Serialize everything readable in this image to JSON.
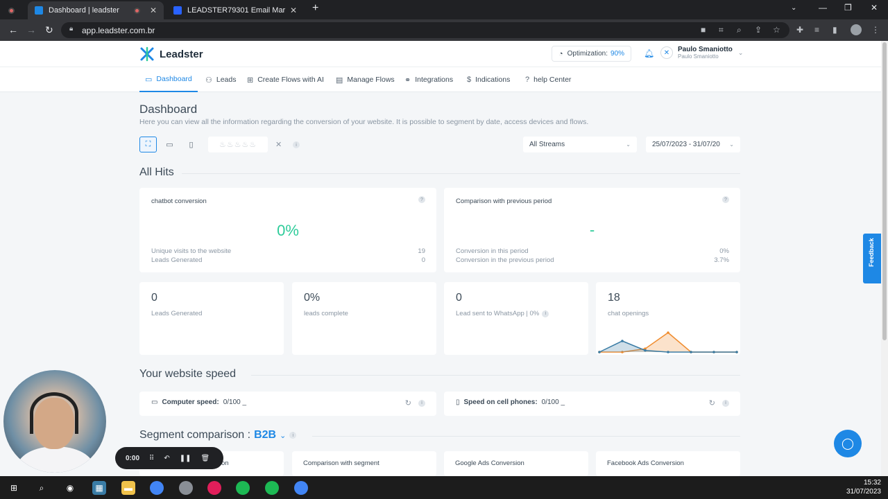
{
  "browser": {
    "tabs": [
      {
        "title": "Dashboard | leadster",
        "active": true
      },
      {
        "title": "LEADSTER79301 Email Marketing",
        "active": false
      }
    ],
    "url": "app.leadster.com.br"
  },
  "header": {
    "brand": "Leadster",
    "optimization_label": "Optimization:",
    "optimization_value": "90%",
    "user_name": "Paulo Smaniotto",
    "user_sub": "Paulo Smaniotto"
  },
  "menu": [
    {
      "label": "Dashboard",
      "icon": "dashboard-icon"
    },
    {
      "label": "Leads",
      "icon": "users-icon"
    },
    {
      "label": "Create Flows with AI",
      "icon": "ai-flow-icon"
    },
    {
      "label": "Manage Flows",
      "icon": "chat-icon"
    },
    {
      "label": "Integrations",
      "icon": "integrations-icon"
    },
    {
      "label": "Indications",
      "icon": "dollar-icon"
    },
    {
      "label": "help Center",
      "icon": "help-icon"
    }
  ],
  "page": {
    "title": "Dashboard",
    "description": "Here you can view all the information regarding the conversion of your website. It is possible to segment by date, access devices and flows."
  },
  "filters": {
    "stream": "All Streams",
    "date_range": "25/07/2023 - 31/07/20"
  },
  "all_hits": {
    "title": "All Hits",
    "chatbot": {
      "title": "chatbot conversion",
      "value": "0%",
      "rows": [
        {
          "label": "Unique visits to the website",
          "value": "19"
        },
        {
          "label": "Leads Generated",
          "value": "0"
        }
      ]
    },
    "comparison": {
      "title": "Comparison with previous period",
      "value": "-",
      "rows": [
        {
          "label": "Conversion in this period",
          "value": "0%"
        },
        {
          "label": "Conversion in the previous period",
          "value": "3.7%"
        }
      ]
    },
    "stats": [
      {
        "value": "0",
        "label": "Leads Generated"
      },
      {
        "value": "0%",
        "label": "leads complete"
      },
      {
        "value": "0",
        "label": "Lead sent to WhatsApp | 0%"
      },
      {
        "value": "18",
        "label": "chat openings"
      }
    ]
  },
  "speed": {
    "title": "Your website speed",
    "computer_label": "Computer speed:",
    "computer_value": "0/100 _",
    "mobile_label": "Speed on cell phones:",
    "mobile_value": "0/100 _"
  },
  "segment": {
    "title": "Segment comparison :",
    "value": "B2B",
    "cards": [
      "rsion",
      "Comparison with segment",
      "Google Ads Conversion",
      "Facebook Ads Conversion"
    ]
  },
  "feedback_label": "Feedback",
  "recorder_time": "0:00",
  "clock": {
    "time": "15:32",
    "date": "31/07/2023"
  },
  "chart_data": {
    "type": "line",
    "series": [
      {
        "values": [
          0,
          2,
          0.3,
          0,
          0,
          0,
          0
        ],
        "color": "#3a7ca5"
      },
      {
        "values": [
          0,
          0,
          0.6,
          3.5,
          0,
          0,
          0
        ],
        "color": "#f08c2e"
      }
    ]
  },
  "colors": {
    "accent": "#1e88e5",
    "success": "#2ecc9a"
  }
}
